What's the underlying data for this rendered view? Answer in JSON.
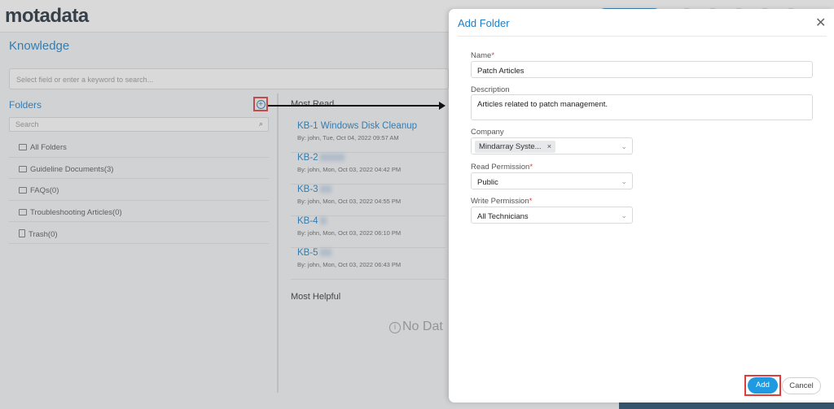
{
  "app": {
    "logo_text": "motadata",
    "page_title": "Knowledge",
    "keyword_search_placeholder": "Select field or enter a keyword to search...",
    "folders_heading": "Folders",
    "folder_search_placeholder": "Search",
    "folders": [
      {
        "label": "All Folders",
        "icon": "folder-icon"
      },
      {
        "label": "Guideline Documents(3)",
        "icon": "folder-icon"
      },
      {
        "label": "FAQs(0)",
        "icon": "folder-icon"
      },
      {
        "label": "Troubleshooting Articles(0)",
        "icon": "folder-icon"
      },
      {
        "label": "Trash(0)",
        "icon": "trash-icon"
      }
    ],
    "most_read_heading": "Most Read",
    "kb_articles": [
      {
        "title": "KB-1 Windows Disk Cleanup",
        "meta": "By: john, Tue, Oct 04, 2022 09:57 AM"
      },
      {
        "title": "KB-2",
        "meta": "By: john, Mon, Oct 03, 2022 04:42 PM"
      },
      {
        "title": "KB-3",
        "meta": "By: john, Mon, Oct 03, 2022 04:55 PM"
      },
      {
        "title": "KB-4",
        "meta": "By: john, Mon, Oct 03, 2022 06:10 PM"
      },
      {
        "title": "KB-5",
        "meta": "By: john, Mon, Oct 03, 2022 06:43 PM"
      }
    ],
    "most_helpful_heading": "Most Helpful",
    "no_data_text": "No Dat"
  },
  "drawer": {
    "title": "Add Folder",
    "close_icon": "close-icon",
    "name_label": "Name",
    "name_value": "Patch Articles",
    "description_label": "Description",
    "description_value": "Articles related to patch management.",
    "company_label": "Company",
    "company_tag": "Mindarray Syste...",
    "read_permission_label": "Read Permission",
    "read_permission_value": "Public",
    "write_permission_label": "Write Permission",
    "write_permission_value": "All Technicians",
    "required_marker": "*",
    "add_button": "Add",
    "cancel_button": "Cancel"
  },
  "colors": {
    "accent": "#1e7fc4",
    "primary_button": "#1f9ae0",
    "highlight": "#e23b3b"
  }
}
